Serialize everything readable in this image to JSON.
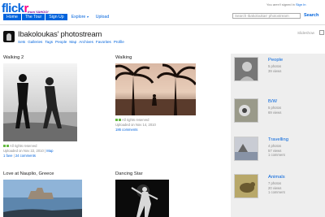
{
  "header": {
    "logo_a": "flick",
    "logo_b": "r",
    "yahoo": "from YAHOO!",
    "nav": [
      "Home",
      "The Tour",
      "Sign Up",
      "Explore",
      "Upload"
    ],
    "signin_text": "You aren't signed in",
    "signin_link": "Sign In",
    "search_placeholder": "Search Ibakoloukas' photostream",
    "search_label": "Search"
  },
  "profile": {
    "title": "Ibakoloukas' photostream",
    "subnav": [
      "Sets",
      "Galleries",
      "Tags",
      "People",
      "Map",
      "Archives",
      "Favorites",
      "Profile"
    ],
    "slideshow": "Slideshow"
  },
  "photos": [
    {
      "title": "Walking 2",
      "rights": "All rights reserved",
      "uploaded": "Uploaded on Nov 22, 2010",
      "map": "Map",
      "faves": "1 fave",
      "comments": "24 comments"
    },
    {
      "title": "Walking",
      "rights": "All rights reserved",
      "uploaded": "Uploaded on Nov 14, 2010",
      "comments": "186 comments"
    },
    {
      "title": "Love at Nauplio, Greece"
    },
    {
      "title": "Dancing Star"
    }
  ],
  "sets": [
    {
      "name": "People",
      "photos": "5 photos",
      "views": "39 views"
    },
    {
      "name": "B/W",
      "photos": "5 photos",
      "views": "69 views"
    },
    {
      "name": "Travelling",
      "photos": "4 photos",
      "views": "57 views",
      "comments": "1 comment"
    },
    {
      "name": "Animals",
      "photos": "7 photos",
      "views": "20 views",
      "comments": "1 comment"
    }
  ]
}
